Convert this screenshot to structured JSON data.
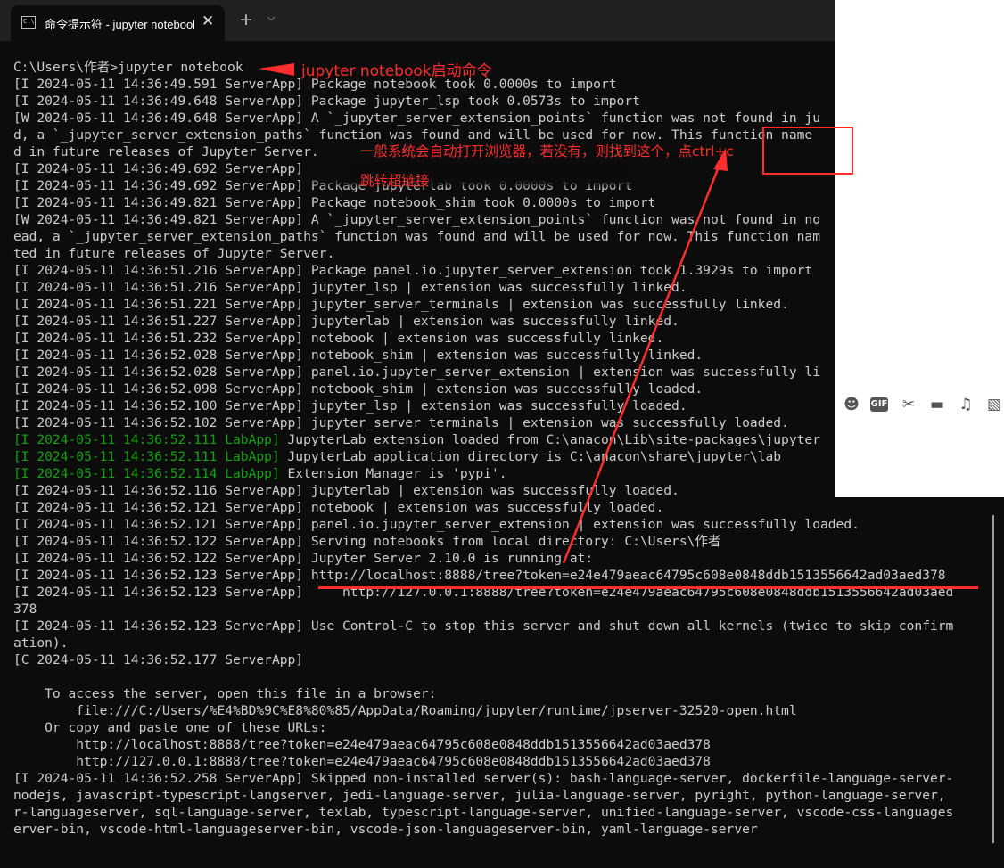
{
  "window": {
    "tab_title": "命令提示符 - jupyter  notebook",
    "tab_icon_text": "C:\\",
    "close_glyph": "✕",
    "new_tab_glyph": "+",
    "dropdown_glyph": "⌵"
  },
  "terminal": {
    "lines": [
      {
        "text": "C:\\Users\\作者>jupyter notebook",
        "style": "normal"
      },
      {
        "text": "[I 2024-05-11 14:36:49.591 ServerApp] Package notebook took 0.0000s to import",
        "style": "normal"
      },
      {
        "text": "[I 2024-05-11 14:36:49.648 ServerApp] Package jupyter_lsp took 0.0573s to import",
        "style": "normal"
      },
      {
        "text": "[W 2024-05-11 14:36:49.648 ServerApp] A `_jupyter_server_extension_points` function was not found in ju",
        "style": "normal"
      },
      {
        "text": "d, a `_jupyter_server_extension_paths` function was found and will be used for now. This function name",
        "style": "normal"
      },
      {
        "text": "d in future releases of Jupyter Server.",
        "style": "normal"
      },
      {
        "text": "[I 2024-05-11 14:36:49.692 ServerApp]",
        "style": "normal"
      },
      {
        "text": "[I 2024-05-11 14:36:49.692 ServerApp] Package jupyterlab took 0.0000s to import",
        "style": "normal"
      },
      {
        "text": "[I 2024-05-11 14:36:49.821 ServerApp] Package notebook_shim took 0.0000s to import",
        "style": "normal"
      },
      {
        "text": "[W 2024-05-11 14:36:49.821 ServerApp] A `_jupyter_server_extension_points` function was not found in no",
        "style": "normal"
      },
      {
        "text": "ead, a `_jupyter_server_extension_paths` function was found and will be used for now. This function nam",
        "style": "normal"
      },
      {
        "text": "ted in future releases of Jupyter Server.",
        "style": "normal"
      },
      {
        "text": "[I 2024-05-11 14:36:51.216 ServerApp] Package panel.io.jupyter_server_extension took 1.3929s to import",
        "style": "normal"
      },
      {
        "text": "[I 2024-05-11 14:36:51.216 ServerApp] jupyter_lsp | extension was successfully linked.",
        "style": "normal"
      },
      {
        "text": "[I 2024-05-11 14:36:51.221 ServerApp] jupyter_server_terminals | extension was successfully linked.",
        "style": "normal"
      },
      {
        "text": "[I 2024-05-11 14:36:51.227 ServerApp] jupyterlab | extension was successfully linked.",
        "style": "normal"
      },
      {
        "text": "[I 2024-05-11 14:36:51.232 ServerApp] notebook | extension was successfully linked.",
        "style": "normal"
      },
      {
        "text": "[I 2024-05-11 14:36:52.028 ServerApp] notebook_shim | extension was successfully linked.",
        "style": "normal"
      },
      {
        "text": "[I 2024-05-11 14:36:52.028 ServerApp] panel.io.jupyter_server_extension | extension was successfully li",
        "style": "normal"
      },
      {
        "text": "[I 2024-05-11 14:36:52.098 ServerApp] notebook_shim | extension was successfully loaded.",
        "style": "normal"
      },
      {
        "text": "[I 2024-05-11 14:36:52.100 ServerApp] jupyter_lsp | extension was successfully loaded.",
        "style": "normal"
      },
      {
        "text": "[I 2024-05-11 14:36:52.102 ServerApp] jupyter_server_terminals | extension was successfully loaded.",
        "style": "normal"
      },
      {
        "prefix": "[I 2024-05-11 14:36:52.111 LabApp]",
        "text": " JupyterLab extension loaded from C:\\anacon\\Lib\\site-packages\\jupyter",
        "style": "green"
      },
      {
        "prefix": "[I 2024-05-11 14:36:52.111 LabApp]",
        "text": " JupyterLab application directory is C:\\anacon\\share\\jupyter\\lab",
        "style": "green"
      },
      {
        "prefix": "[I 2024-05-11 14:36:52.114 LabApp]",
        "text": " Extension Manager is 'pypi'.",
        "style": "green"
      },
      {
        "text": "[I 2024-05-11 14:36:52.116 ServerApp] jupyterlab | extension was successfully loaded.",
        "style": "normal"
      },
      {
        "text": "[I 2024-05-11 14:36:52.121 ServerApp] notebook | extension was successfully loaded.",
        "style": "normal"
      },
      {
        "text": "[I 2024-05-11 14:36:52.121 ServerApp] panel.io.jupyter_server_extension | extension was successfully loaded.",
        "style": "normal"
      },
      {
        "text": "[I 2024-05-11 14:36:52.122 ServerApp] Serving notebooks from local directory: C:\\Users\\作者",
        "style": "normal"
      },
      {
        "text": "[I 2024-05-11 14:36:52.122 ServerApp] Jupyter Server 2.10.0 is running at:",
        "style": "normal"
      },
      {
        "text": "[I 2024-05-11 14:36:52.123 ServerApp] http://localhost:8888/tree?token=e24e479aeac64795c608e0848ddb1513556642ad03aed378",
        "style": "normal"
      },
      {
        "text": "[I 2024-05-11 14:36:52.123 ServerApp]     http://127.0.0.1:8888/tree?token=e24e479aeac64795c608e0848ddb1513556642ad03aed",
        "style": "normal"
      },
      {
        "text": "378",
        "style": "normal"
      },
      {
        "text": "[I 2024-05-11 14:36:52.123 ServerApp] Use Control-C to stop this server and shut down all kernels (twice to skip confirm",
        "style": "normal"
      },
      {
        "text": "ation).",
        "style": "normal"
      },
      {
        "text": "[C 2024-05-11 14:36:52.177 ServerApp]",
        "style": "normal"
      },
      {
        "text": "",
        "style": "normal"
      },
      {
        "text": "    To access the server, open this file in a browser:",
        "style": "normal"
      },
      {
        "text": "        file:///C:/Users/%E4%BD%9C%E8%80%85/AppData/Roaming/jupyter/runtime/jpserver-32520-open.html",
        "style": "normal"
      },
      {
        "text": "    Or copy and paste one of these URLs:",
        "style": "normal"
      },
      {
        "text": "        http://localhost:8888/tree?token=e24e479aeac64795c608e0848ddb1513556642ad03aed378",
        "style": "normal"
      },
      {
        "text": "        http://127.0.0.1:8888/tree?token=e24e479aeac64795c608e0848ddb1513556642ad03aed378",
        "style": "normal"
      },
      {
        "text": "[I 2024-05-11 14:36:52.258 ServerApp] Skipped non-installed server(s): bash-language-server, dockerfile-language-server-",
        "style": "normal"
      },
      {
        "text": "nodejs, javascript-typescript-langserver, jedi-language-server, julia-language-server, pyright, python-language-server,",
        "style": "normal"
      },
      {
        "text": "r-languageserver, sql-language-server, texlab, typescript-language-server, unified-language-server, vscode-css-languages",
        "style": "normal"
      },
      {
        "text": "erver-bin, vscode-html-languageserver-bin, vscode-json-languageserver-bin, yaml-language-server",
        "style": "normal"
      }
    ]
  },
  "annotations": {
    "command_label": "jupyter notebook启动命令",
    "hint_line1": "一般系统会自动打开浏览器，若没有，则找到这个，点ctrl+c",
    "hint_line2": "跳转超链接",
    "color": "#ff2d2d"
  },
  "chat_toolbar": {
    "icons": [
      {
        "name": "emoji-icon",
        "glyph": "☻"
      },
      {
        "name": "gif-icon",
        "glyph": "GIF"
      },
      {
        "name": "scissors-icon",
        "glyph": "✂"
      },
      {
        "name": "folder-icon",
        "glyph": "▬"
      },
      {
        "name": "music-icon",
        "glyph": "♫"
      },
      {
        "name": "image-icon",
        "glyph": "▧"
      }
    ]
  }
}
